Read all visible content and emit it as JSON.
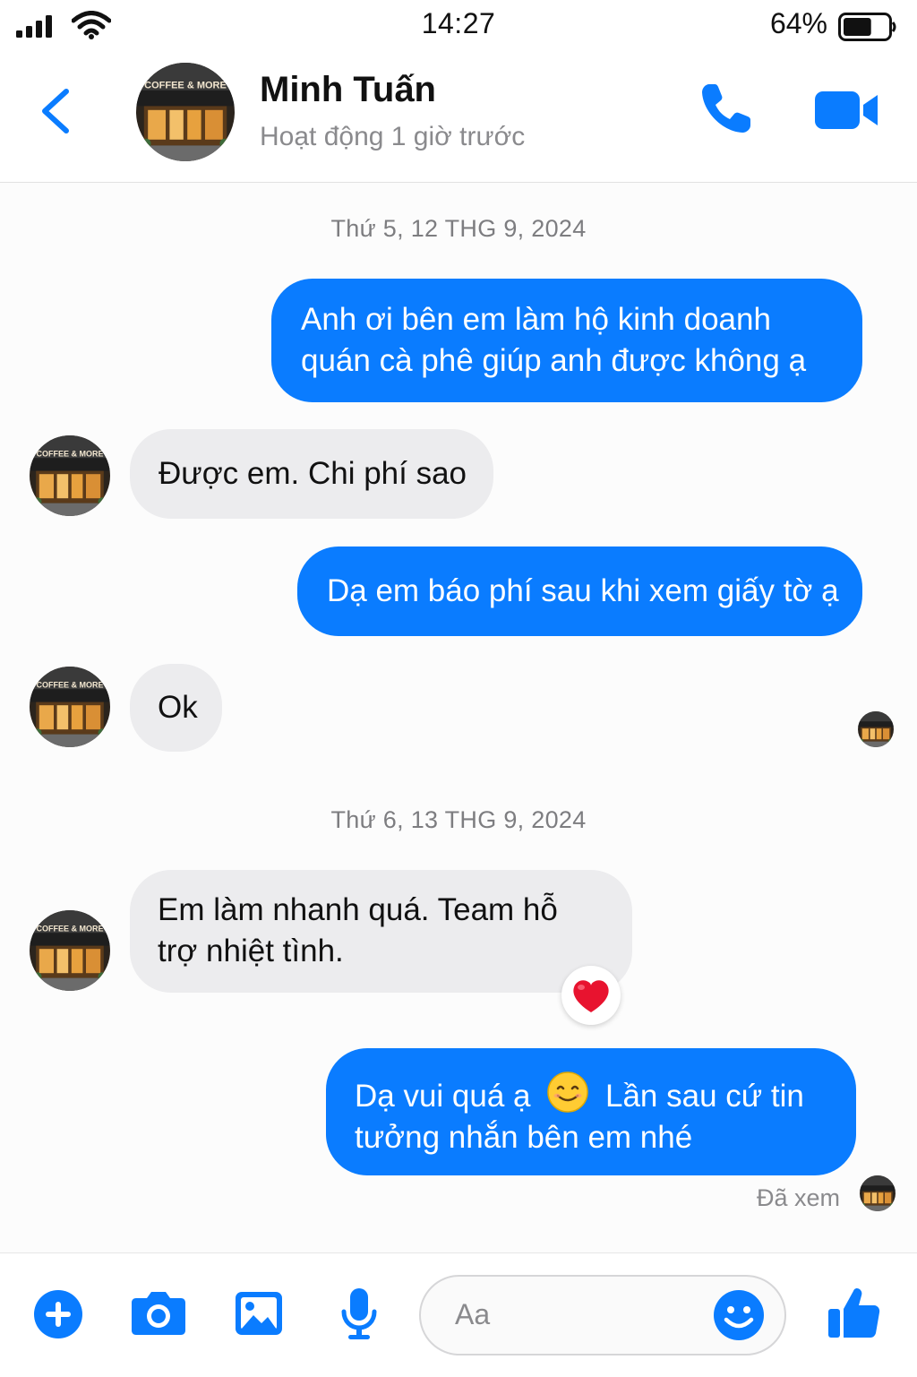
{
  "status_bar": {
    "time": "14:27",
    "battery_percent": "64%",
    "battery_level": 0.64
  },
  "header": {
    "contact_name": "Minh Tuấn",
    "contact_status": "Hoạt động 1 giờ trước",
    "avatar_sign": "COFFEE & MORE"
  },
  "colors": {
    "accent": "#0a7cff",
    "incoming_bubble": "#ececee",
    "heart": "#e8132f"
  },
  "chat": {
    "date_1": "Thứ 5, 12 THG 9, 2024",
    "date_2": "Thứ 6, 13 THG 9, 2024",
    "messages": [
      {
        "from": "me",
        "text": "Anh ơi bên em làm hộ kinh doanh quán cà phê giúp anh được không ạ"
      },
      {
        "from": "contact",
        "text": "Được em. Chi phí sao"
      },
      {
        "from": "me",
        "text": "Dạ em báo phí sau khi xem giấy tờ ạ"
      },
      {
        "from": "contact",
        "text": "Ok"
      },
      {
        "from": "contact",
        "text": "Em làm nhanh quá. Team hỗ trợ nhiệt tình.",
        "reaction": "heart-icon"
      },
      {
        "from": "me",
        "text_part1": "Dạ vui quá ạ",
        "emoji": "smiling-face-icon",
        "text_part2": "Lần sau cứ tin tưởng nhắn bên em nhé"
      }
    ],
    "seen_label": "Đã xem"
  },
  "composer": {
    "placeholder": "Aa",
    "icons": [
      "plus-icon",
      "camera-icon",
      "image-icon",
      "microphone-icon",
      "emoji-icon",
      "thumbs-up-icon"
    ]
  }
}
